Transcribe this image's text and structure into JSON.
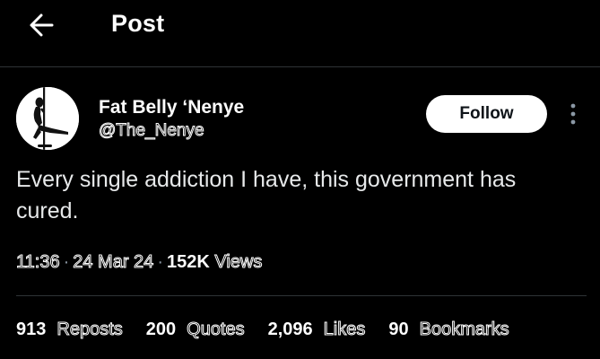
{
  "header": {
    "back_icon": "arrow-left-icon",
    "title": "Post"
  },
  "author": {
    "name": "Fat Belly ‘Nenye",
    "handle": "@The_Nenye",
    "avatar_icon": "pole-dancer-silhouette"
  },
  "follow_label": "Follow",
  "more_icon": "more-vertical-icon",
  "post": {
    "text": "Every single addiction I have, this government has cured."
  },
  "meta": {
    "time": "11:36",
    "separator": "·",
    "date": "24 Mar 24",
    "views_count": "152K",
    "views_label": "Views"
  },
  "stats": [
    {
      "count": "913",
      "label": "Reposts"
    },
    {
      "count": "200",
      "label": "Quotes"
    },
    {
      "count": "2,096",
      "label": "Likes"
    },
    {
      "count": "90",
      "label": "Bookmarks"
    }
  ],
  "colors": {
    "background": "#000000",
    "text_primary": "#e7e9ea",
    "divider": "#2f3336",
    "follow_bg": "#ffffff",
    "follow_text": "#0f1419"
  }
}
